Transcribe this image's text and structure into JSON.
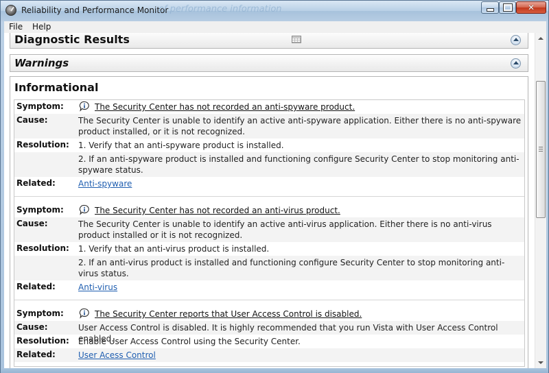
{
  "window": {
    "title": "Reliability and Performance Monitor",
    "title_ghost": "of performance information"
  },
  "menu": {
    "items": [
      "File",
      "Help"
    ]
  },
  "sections": {
    "diagnostic": "Diagnostic Results",
    "warnings": "Warnings",
    "informational": "Informational"
  },
  "labels": {
    "symptom": "Symptom:",
    "cause": "Cause:",
    "resolution": "Resolution:",
    "related": "Related:"
  },
  "entries": [
    {
      "symptom": "The Security Center has not recorded an anti-spyware product.",
      "cause": "The Security Center is unable to identify an active anti-spyware application. Either there is no anti-spyware product installed, or it is not recognized.",
      "resolution": [
        "1. Verify that an anti-spyware product is installed.",
        "2. If an anti-spyware product is installed and functioning configure Security Center to stop monitoring anti-spyware status."
      ],
      "related": "Anti-spyware"
    },
    {
      "symptom": "The Security Center has not recorded an anti-virus product.",
      "cause": "The Security Center is unable to identify an active anti-virus application. Either there is no anti-virus product installed or it is not recognized.",
      "resolution": [
        "1. Verify that an anti-virus product is installed.",
        "2. If an anti-virus product is installed and functioning configure Security Center to stop monitoring anti-virus status."
      ],
      "related": "Anti-virus"
    },
    {
      "symptom": "The Security Center reports that User Access Control is disabled.",
      "cause": "User Access Control is disabled. It is highly recommended that you run Vista with User Access Control enabled.",
      "resolution": [
        "Enable User Access Control using the Security Center."
      ],
      "related": "User Acess Control"
    }
  ],
  "icons": {
    "app": "performance-monitor-icon",
    "symptom": "info-bubble-icon",
    "collapse": "chevron-up-icon",
    "view": "table-icon"
  },
  "colors": {
    "link": "#1f5eb0",
    "shaded_row": "#f3f3f3"
  }
}
